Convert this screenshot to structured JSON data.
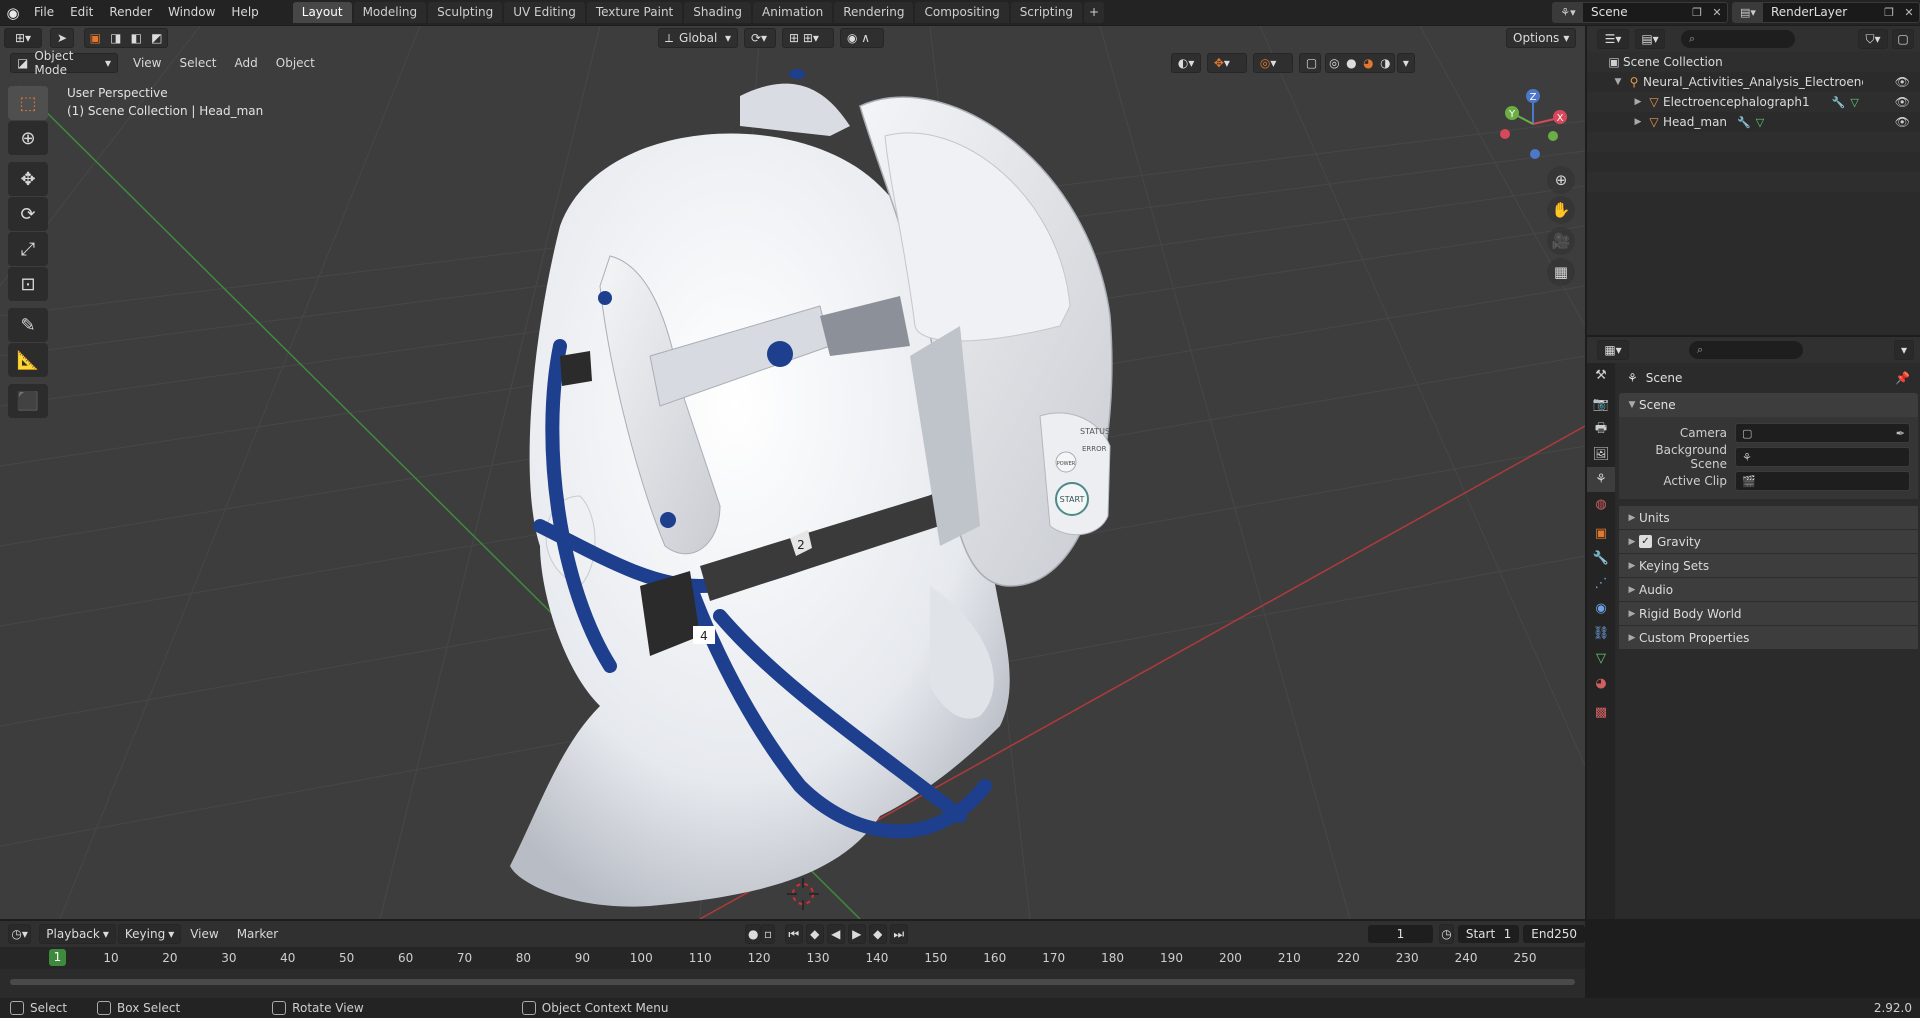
{
  "top_menu": [
    "File",
    "Edit",
    "Render",
    "Window",
    "Help"
  ],
  "workspace_tabs": [
    "Layout",
    "Modeling",
    "Sculpting",
    "UV Editing",
    "Texture Paint",
    "Shading",
    "Animation",
    "Rendering",
    "Compositing",
    "Scripting"
  ],
  "active_workspace": "Layout",
  "add_tab_label": "+",
  "scene_name": "Scene",
  "view_layer": "RenderLayer",
  "viewport": {
    "mode": "Object Mode",
    "menus": [
      "View",
      "Select",
      "Add",
      "Object"
    ],
    "transform_orientation": "Global",
    "options_label": "Options",
    "info_line1": "User Perspective",
    "info_line2": "(1) Scene Collection | Head_man",
    "gizmo_axes": [
      "X",
      "Y",
      "Z"
    ]
  },
  "outliner": {
    "search_placeholder": "",
    "root": "Scene Collection",
    "rows": [
      {
        "label": "Neural_Activities_Analysis_Electroencephalc",
        "depth": 1,
        "type": "collection"
      },
      {
        "label": "Electroencephalograph1",
        "depth": 2,
        "type": "object"
      },
      {
        "label": "Head_man",
        "depth": 2,
        "type": "object"
      }
    ]
  },
  "properties": {
    "context_title": "Scene",
    "panel_title": "Scene",
    "fields": [
      {
        "label": "Camera",
        "value": ""
      },
      {
        "label": "Background Scene",
        "value": ""
      },
      {
        "label": "Active Clip",
        "value": ""
      }
    ],
    "subpanels": [
      "Units",
      "Gravity",
      "Keying Sets",
      "Audio",
      "Rigid Body World",
      "Custom Properties"
    ],
    "gravity_checked": true
  },
  "timeline": {
    "menus": [
      "Playback",
      "Keying",
      "View",
      "Marker"
    ],
    "current_frame": "1",
    "start_label": "Start",
    "start_value": "1",
    "end_label": "End",
    "end_value": "250",
    "ruler_ticks": [
      "1",
      "10",
      "20",
      "30",
      "40",
      "50",
      "60",
      "70",
      "80",
      "90",
      "100",
      "110",
      "120",
      "130",
      "140",
      "150",
      "160",
      "170",
      "180",
      "190",
      "200",
      "210",
      "220",
      "230",
      "240",
      "250"
    ]
  },
  "statusbar": {
    "select": "Select",
    "box_select": "Box Select",
    "rotate_view": "Rotate View",
    "context_menu": "Object Context Menu",
    "version": "2.92.0"
  },
  "model_labels": {
    "status": "STATUS",
    "error": "ERROR",
    "power": "POWER",
    "start": "START",
    "marker_2": "2",
    "marker_4": "4"
  },
  "colors": {
    "accent_blue": "#4772b3",
    "header_orange": "#e0792f",
    "strap_blue": "#1d3f8e",
    "frame_green": "#3d8a3d"
  }
}
